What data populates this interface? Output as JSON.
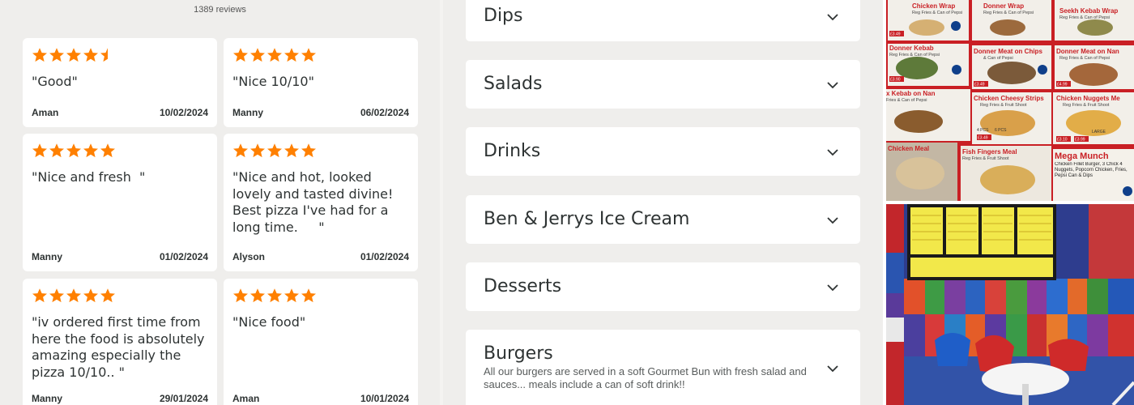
{
  "reviews": {
    "count_label": "1389 reviews",
    "items": [
      {
        "rating": 4.5,
        "text": "\"Good\"",
        "author": "Aman",
        "date": "10/02/2024"
      },
      {
        "rating": 5,
        "text": "\"Nice 10/10\"",
        "author": "Manny",
        "date": "06/02/2024"
      },
      {
        "rating": 5,
        "text": "\"Nice and fresh  \"",
        "author": "Manny",
        "date": "01/02/2024"
      },
      {
        "rating": 5,
        "text": "\"Nice and hot, looked lovely and tasted divine! Best pizza I've had for a long time.     \"",
        "author": "Alyson",
        "date": "01/02/2024"
      },
      {
        "rating": 5,
        "text": "\"iv ordered first time from here the food is absolutely amazing especially the pizza 10/10.. \"",
        "author": "Manny",
        "date": "29/01/2024"
      },
      {
        "rating": 5,
        "text": "\"Nice food\"",
        "author": "Aman",
        "date": "10/01/2024"
      }
    ]
  },
  "menu": {
    "categories": [
      {
        "title": "Dips",
        "description": ""
      },
      {
        "title": "Salads",
        "description": ""
      },
      {
        "title": "Drinks",
        "description": ""
      },
      {
        "title": "Ben & Jerrys Ice Cream",
        "description": ""
      },
      {
        "title": "Desserts",
        "description": ""
      },
      {
        "title": "Burgers",
        "description": "All our burgers are served in a soft Gourmet Bun with fresh salad and sauces... meals include a can of soft drink!!"
      }
    ]
  },
  "photos": {
    "menu_board": {
      "items": [
        {
          "label": "Chicken Wrap",
          "sub": "Reg Fries & Can of Pepsi"
        },
        {
          "label": "Donner Wrap",
          "sub": "Reg Fries & Can of Pepsi"
        },
        {
          "label": "Seekh Kebab Wrap",
          "sub": "Reg Fries & Can of Pepsi"
        },
        {
          "label": "Donner Kebab",
          "sub": "Reg Fries & Can of Pepsi"
        },
        {
          "label": "Donner Meat on Chips",
          "sub": "& Can of Pepsi"
        },
        {
          "label": "Donner Meat on Nan",
          "sub": "Reg Fries & Can of Pepsi"
        },
        {
          "label": "x Kebab on Nan",
          "sub": "Fries & Can of Pepsi"
        },
        {
          "label": "Chicken Cheesy Strips",
          "sub": "Reg Fries & Fruit Shoot"
        },
        {
          "label": "Chicken Nuggets Me",
          "sub": "Reg Fries & Fruit Shoot"
        },
        {
          "label": "Chicken Meal",
          "sub": ""
        },
        {
          "label": "Fish Fingers Meal",
          "sub": "Reg Fries & Fruit Shoot"
        },
        {
          "label": "Mega Munch",
          "sub": "Chicken Fillet Burger, 3 Chick 4 Nuggets, Popcorn Chicken, Fries, Pepsi Can & Dips"
        }
      ],
      "prices": [
        "£3.49",
        "£3.90",
        "£3.49",
        "£4.99",
        "£3.10",
        "£3.99",
        "£3.49",
        "4 PCS",
        "6 PCS",
        "LARGE"
      ]
    }
  },
  "colors": {
    "star": "#ff8000",
    "text": "#2e3333",
    "background": "#efeeec",
    "card": "#ffffff"
  }
}
